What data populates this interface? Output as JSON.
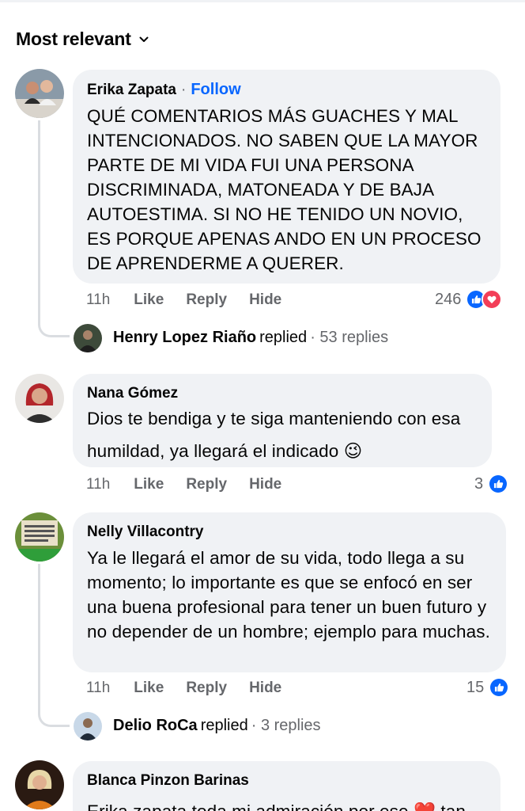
{
  "header": {
    "sort_label": "Most relevant"
  },
  "comments": [
    {
      "author": "Erika Zapata",
      "follow_label": "Follow",
      "text": "QUÉ COMENTARIOS MÁS GUACHES Y MAL INTENCIONADOS. NO SABEN QUE LA MAYOR PARTE DE MI VIDA FUI UNA PERSONA DISCRIMINADA, MATONEADA Y DE BAJA AUTOESTIMA. SI NO HE TENIDO UN NOVIO, ES PORQUE APENAS ANDO EN UN PROCESO DE APRENDERME A QUERER.",
      "time": "11h",
      "like": "Like",
      "reply": "Reply",
      "hide": "Hide",
      "reaction_count": "246",
      "reactions": [
        "like",
        "love"
      ],
      "replies": {
        "name": "Henry Lopez Riaño",
        "replied": "replied",
        "count": "· 53 replies"
      }
    },
    {
      "author": "Nana Gómez",
      "text": "Dios te bendiga y te siga manteniendo con esa humildad, ya llegará el indicado 😉",
      "time": "11h",
      "like": "Like",
      "reply": "Reply",
      "hide": "Hide",
      "reaction_count": "3",
      "reactions": [
        "like"
      ]
    },
    {
      "author": "Nelly Villacontry",
      "text": "Ya le llegará el amor de su vida, todo llega a su momento; lo importante es que se enfocó en ser una buena profesional para tener un buen futuro y no depender de un hombre; ejemplo para muchas.",
      "time": "11h",
      "like": "Like",
      "reply": "Reply",
      "hide": "Hide",
      "reaction_count": "15",
      "reactions": [
        "like"
      ],
      "replies": {
        "name": "Delio RoCa",
        "replied": "replied",
        "count": "· 3 replies"
      }
    },
    {
      "author": "Blanca Pinzon Barinas",
      "text": "Erika zapata toda mi admiración por ese ❤️ tan"
    }
  ],
  "colors": {
    "accent": "#0866ff",
    "bubble": "#f0f2f5",
    "muted": "#65676b",
    "love": "#f33e58"
  }
}
